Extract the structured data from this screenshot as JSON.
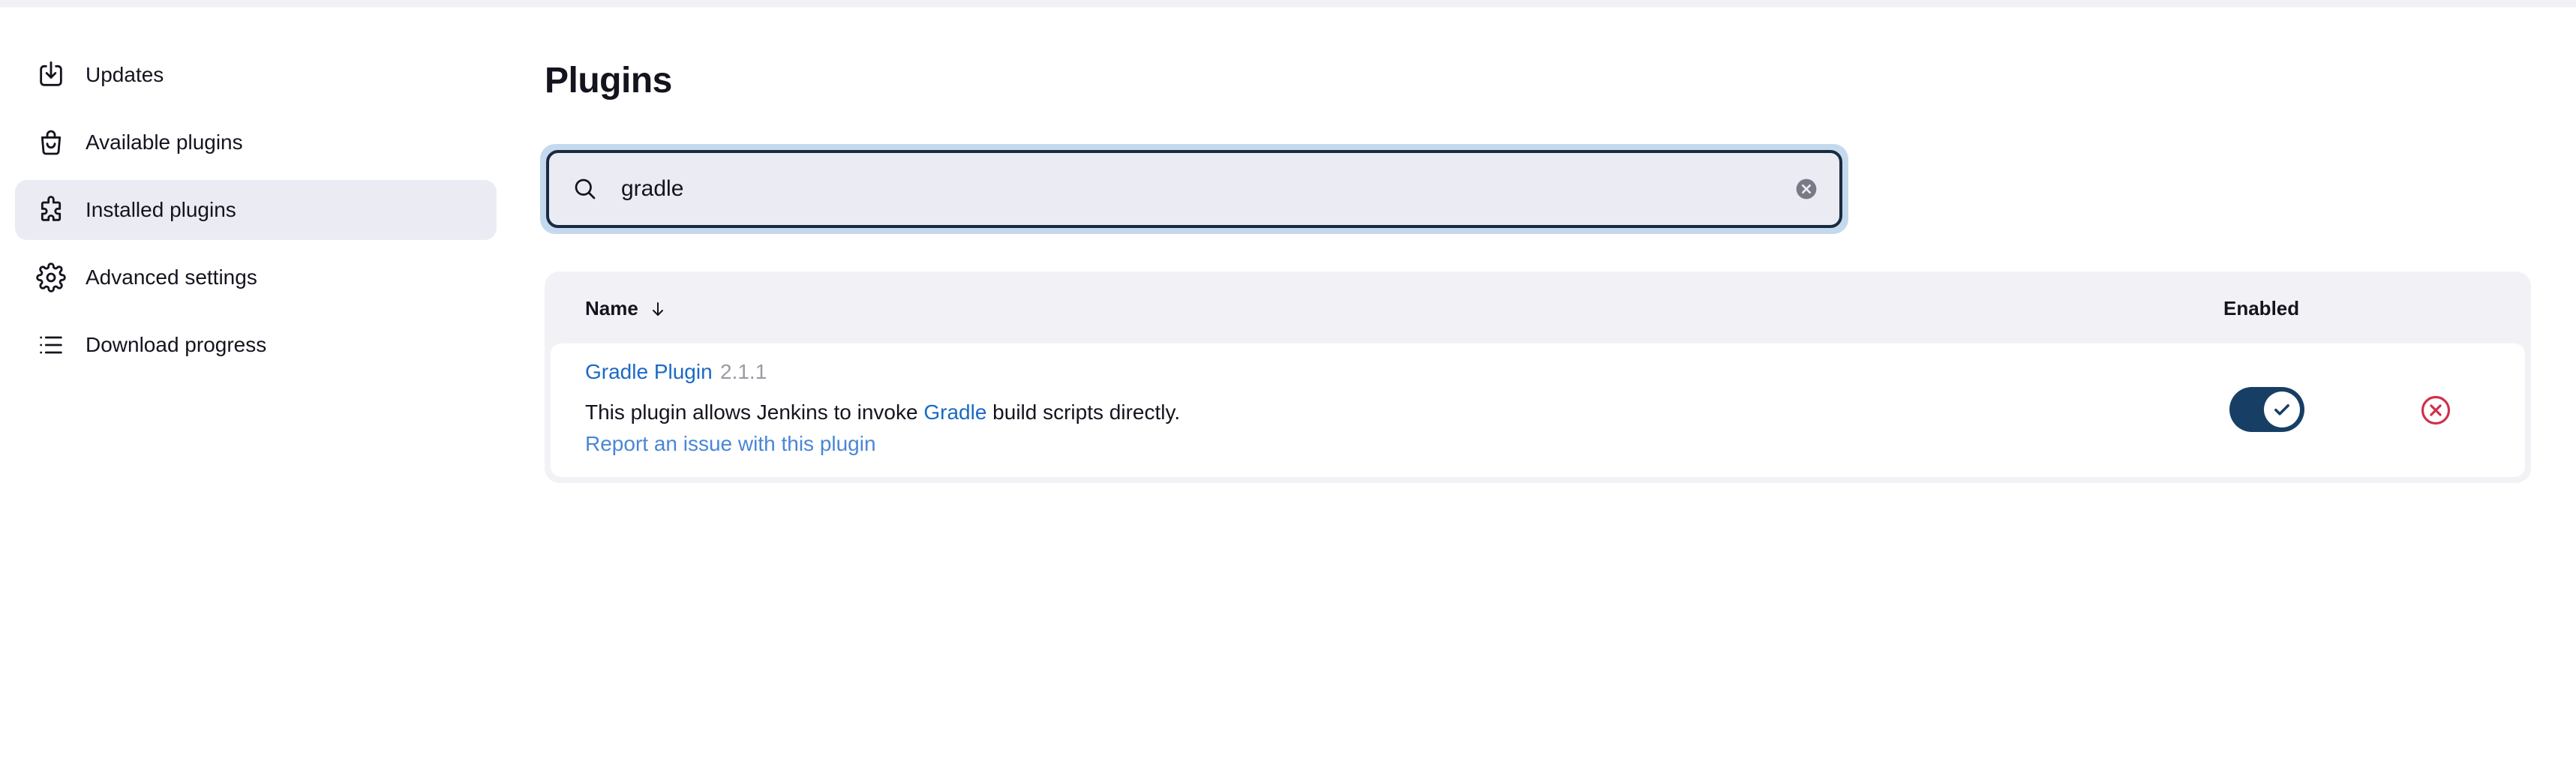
{
  "sidebar": {
    "items": [
      {
        "label": "Updates",
        "icon": "download-icon",
        "active": false
      },
      {
        "label": "Available plugins",
        "icon": "shopping-bag-icon",
        "active": false
      },
      {
        "label": "Installed plugins",
        "icon": "puzzle-icon",
        "active": true
      },
      {
        "label": "Advanced settings",
        "icon": "gear-icon",
        "active": false
      },
      {
        "label": "Download progress",
        "icon": "list-icon",
        "active": false
      }
    ]
  },
  "main": {
    "title": "Plugins",
    "search": {
      "value": "gradle",
      "placeholder": ""
    },
    "table": {
      "columns": {
        "name": "Name",
        "enabled": "Enabled"
      },
      "sort": "descending-arrow",
      "rows": [
        {
          "name": "Gradle Plugin",
          "version": "2.1.1",
          "description_before": "This plugin allows Jenkins to invoke ",
          "description_link": "Gradle",
          "description_after": " build scripts directly.",
          "report_link": "Report an issue with this plugin",
          "enabled": true
        }
      ]
    }
  },
  "colors": {
    "accent": "#1b69c5",
    "toggle_on": "#173f66",
    "danger": "#d0304a",
    "active_bg": "#ebebf3"
  }
}
